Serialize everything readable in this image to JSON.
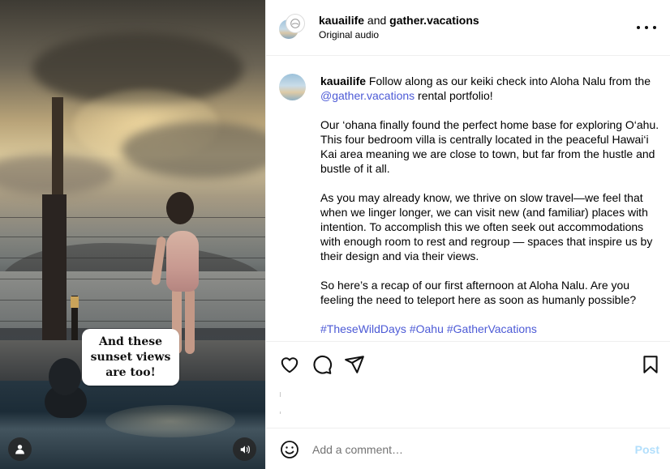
{
  "media": {
    "sticker_line1": "And these",
    "sticker_line2": "sunset views",
    "sticker_line3": "are too!",
    "user_tag_icon": "person-icon",
    "audio_icon": "speaker-icon"
  },
  "header": {
    "author1": "kauailife",
    "joiner": " and ",
    "author2": "gather.vacations",
    "audio_label": "Original audio",
    "more_icon": "more-horizontal-icon"
  },
  "caption": {
    "username": "kauailife",
    "p1_text": " Follow along as our keiki check into Aloha Nalu from the ",
    "p1_mention": "@gather.vacations",
    "p1_end": " rental portfolio!",
    "p2": "Our ‘ohana finally found the perfect home base for exploring O‘ahu. This four bedroom villa is centrally located in the peaceful Hawai‘i Kai area meaning we are close to town, but far from the hustle and bustle of it all.",
    "p3": "As you may already know, we thrive on slow travel—we feel that when we linger longer, we can visit new (and familiar) places with intention. To accomplish this we often seek out accommodations with enough room to rest and regroup — spaces that inspire us by their design and via their views.",
    "p4": "So here’s a recap of our first afternoon at Aloha Nalu. Are you feeling the need to teleport here as soon as humanly possible?",
    "hashtags": [
      "#TheseWildDays",
      "#Oahu",
      "#GatherVacations"
    ]
  },
  "actions": {
    "like_icon": "heart-icon",
    "comment_icon": "comment-icon",
    "share_icon": "send-icon",
    "save_icon": "bookmark-icon"
  },
  "comment": {
    "placeholder": "Add a comment…",
    "post_label": "Post",
    "emoji_icon": "smiley-icon"
  },
  "colors": {
    "link": "#4c5ad6",
    "post_disabled": "#b2dffc",
    "divider": "#efefef"
  }
}
